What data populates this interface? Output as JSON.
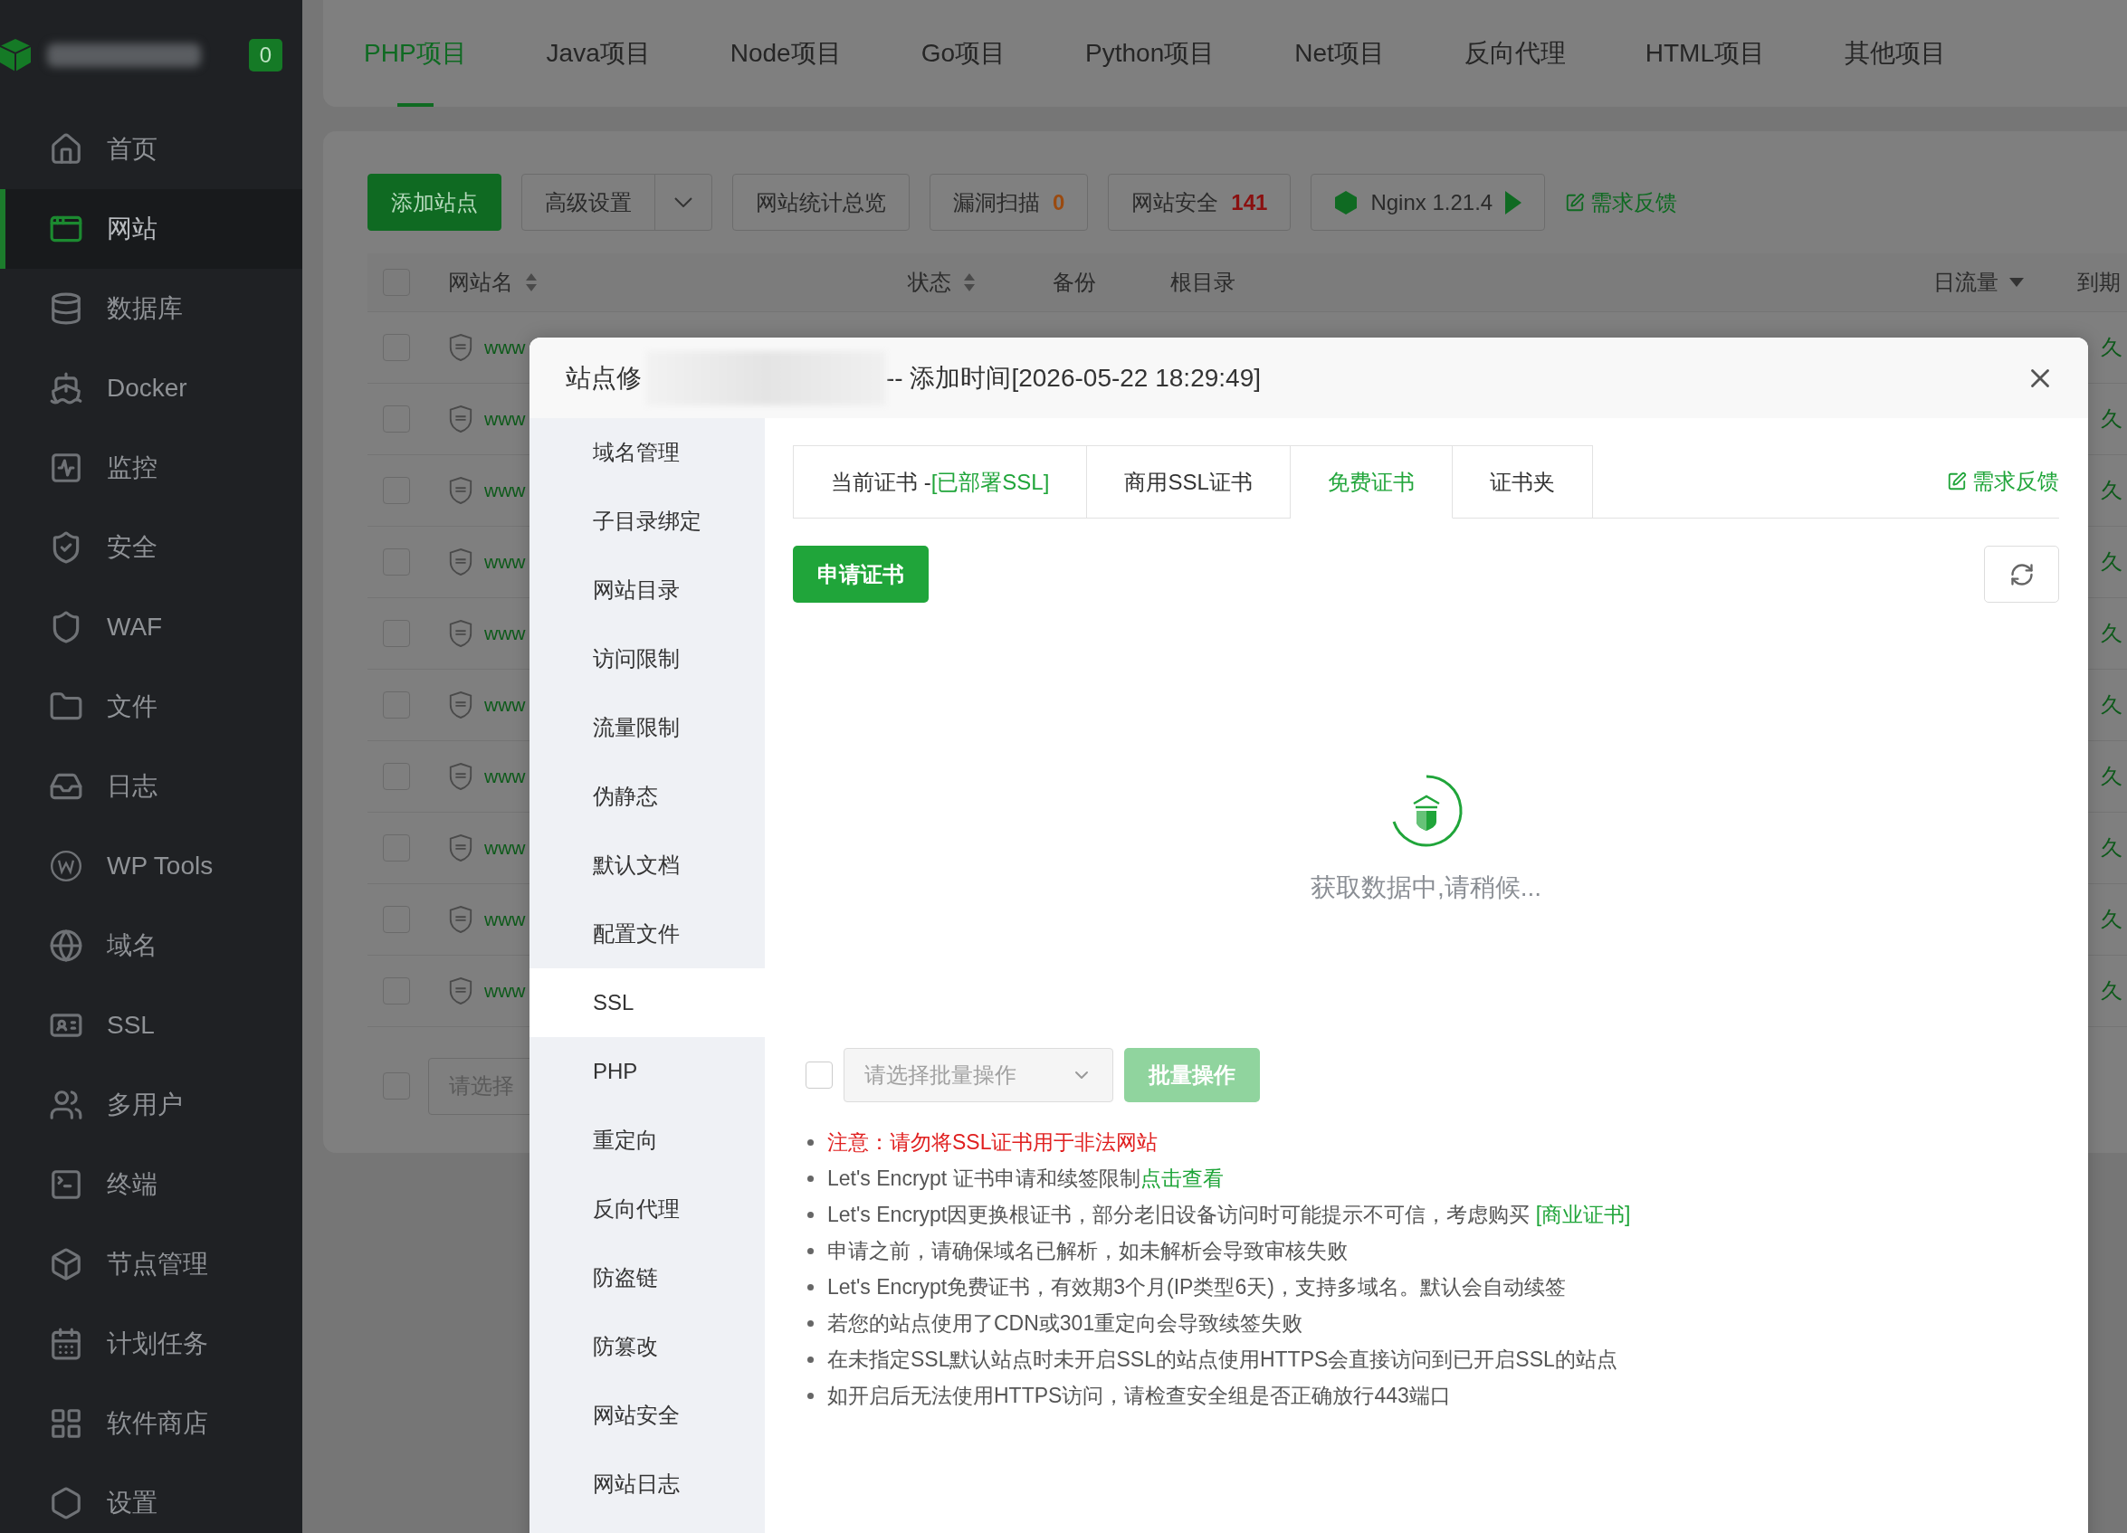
{
  "sidebar": {
    "badge": "0",
    "items": [
      {
        "label": "首页",
        "selected": false
      },
      {
        "label": "网站",
        "selected": true
      },
      {
        "label": "数据库",
        "selected": false
      },
      {
        "label": "Docker",
        "selected": false
      },
      {
        "label": "监控",
        "selected": false
      },
      {
        "label": "安全",
        "selected": false
      },
      {
        "label": "WAF",
        "selected": false
      },
      {
        "label": "文件",
        "selected": false
      },
      {
        "label": "日志",
        "selected": false
      },
      {
        "label": "WP Tools",
        "selected": false
      },
      {
        "label": "域名",
        "selected": false
      },
      {
        "label": "SSL",
        "selected": false
      },
      {
        "label": "多用户",
        "selected": false
      },
      {
        "label": "终端",
        "selected": false
      },
      {
        "label": "节点管理",
        "selected": false
      },
      {
        "label": "计划任务",
        "selected": false
      },
      {
        "label": "软件商店",
        "selected": false
      },
      {
        "label": "设置",
        "selected": false
      }
    ]
  },
  "project_tabs": [
    {
      "label": "PHP项目",
      "selected": true
    },
    {
      "label": "Java项目",
      "selected": false
    },
    {
      "label": "Node项目",
      "selected": false
    },
    {
      "label": "Go项目",
      "selected": false
    },
    {
      "label": "Python项目",
      "selected": false
    },
    {
      "label": "Net项目",
      "selected": false
    },
    {
      "label": "反向代理",
      "selected": false
    },
    {
      "label": "HTML项目",
      "selected": false
    },
    {
      "label": "其他项目",
      "selected": false
    }
  ],
  "toolbar": {
    "add_button": "添加站点",
    "advanced_button": "高级设置",
    "stats_button": "网站统计总览",
    "scan": {
      "label": "漏洞扫描",
      "count": "0"
    },
    "security": {
      "label": "网站安全",
      "count": "141"
    },
    "nginx": "Nginx 1.21.4",
    "feedback": "需求反馈"
  },
  "table": {
    "columns": [
      {
        "label": "网站名",
        "kind": "sort"
      },
      {
        "label": "状态",
        "kind": "sort"
      },
      {
        "label": "备份",
        "kind": "plain"
      },
      {
        "label": "根目录",
        "kind": "plain"
      },
      {
        "label": "日流量",
        "kind": "dropdown"
      },
      {
        "label": "到期",
        "kind": "plain"
      }
    ],
    "header_checked": false,
    "batch_checked": false,
    "rows": [
      {
        "checked": false,
        "name": "www",
        "column_6": "久"
      },
      {
        "checked": false,
        "name": "www",
        "column_6": "久"
      },
      {
        "checked": false,
        "name": "www",
        "column_6": "久"
      },
      {
        "checked": false,
        "name": "www",
        "column_6": "久"
      },
      {
        "checked": false,
        "name": "www",
        "column_6": "久"
      },
      {
        "checked": false,
        "name": "www",
        "column_6": "久"
      },
      {
        "checked": false,
        "name": "www",
        "column_6": "久"
      },
      {
        "checked": false,
        "name": "www",
        "column_6": "久"
      },
      {
        "checked": false,
        "name": "www",
        "column_6": "久"
      },
      {
        "checked": false,
        "name": "www",
        "column_6": "久"
      }
    ],
    "batch_placeholder": "请选择"
  },
  "modal": {
    "title": "站点修",
    "subtitle": "-- 添加时间[2026-05-22 18:29:49]",
    "nav": [
      {
        "label": "域名管理",
        "selected": false
      },
      {
        "label": "子目录绑定",
        "selected": false
      },
      {
        "label": "网站目录",
        "selected": false
      },
      {
        "label": "访问限制",
        "selected": false
      },
      {
        "label": "流量限制",
        "selected": false
      },
      {
        "label": "伪静态",
        "selected": false
      },
      {
        "label": "默认文档",
        "selected": false
      },
      {
        "label": "配置文件",
        "selected": false
      },
      {
        "label": "SSL",
        "selected": true
      },
      {
        "label": "PHP",
        "selected": false
      },
      {
        "label": "重定向",
        "selected": false
      },
      {
        "label": "反向代理",
        "selected": false
      },
      {
        "label": "防盗链",
        "selected": false
      },
      {
        "label": "防篡改",
        "selected": false
      },
      {
        "label": "网站安全",
        "selected": false
      },
      {
        "label": "网站日志",
        "selected": false
      }
    ],
    "tabs": [
      {
        "label": "当前证书 -",
        "badge": "[已部署SSL]",
        "selected": false
      },
      {
        "label": "商用SSL证书",
        "selected": false
      },
      {
        "label": "免费证书",
        "selected": true
      },
      {
        "label": "证书夹",
        "selected": false
      }
    ],
    "feedback": "需求反馈",
    "apply_button": "申请证书",
    "loading_text": "获取数据中,请稍候...",
    "batch": {
      "checked": false,
      "placeholder": "请选择批量操作",
      "button": "批量操作",
      "disabled": true
    },
    "notes": [
      {
        "kind": "warning",
        "text": "注意：请勿将SSL证书用于非法网站"
      },
      {
        "kind": "plain",
        "text": "Let's Encrypt 证书申请和续签限制",
        "link": "点击查看"
      },
      {
        "kind": "plain",
        "text": "Let's Encrypt因更换根证书，部分老旧设备访问时可能提示不可信，考虑购买 ",
        "link": "[商业证书]"
      },
      {
        "kind": "plain",
        "text": "申请之前，请确保域名已解析，如未解析会导致审核失败"
      },
      {
        "kind": "plain",
        "text": "Let's Encrypt免费证书，有效期3个月(IP类型6天)，支持多域名。默认会自动续签"
      },
      {
        "kind": "plain",
        "text": "若您的站点使用了CDN或301重定向会导致续签失败"
      },
      {
        "kind": "plain",
        "text": "在未指定SSL默认站点时未开启SSL的站点使用HTTPS会直接访问到已开启SSL的站点"
      },
      {
        "kind": "plain",
        "text": "如开启后无法使用HTTPS访问，请检查安全组是否正确放行443端口"
      }
    ]
  }
}
